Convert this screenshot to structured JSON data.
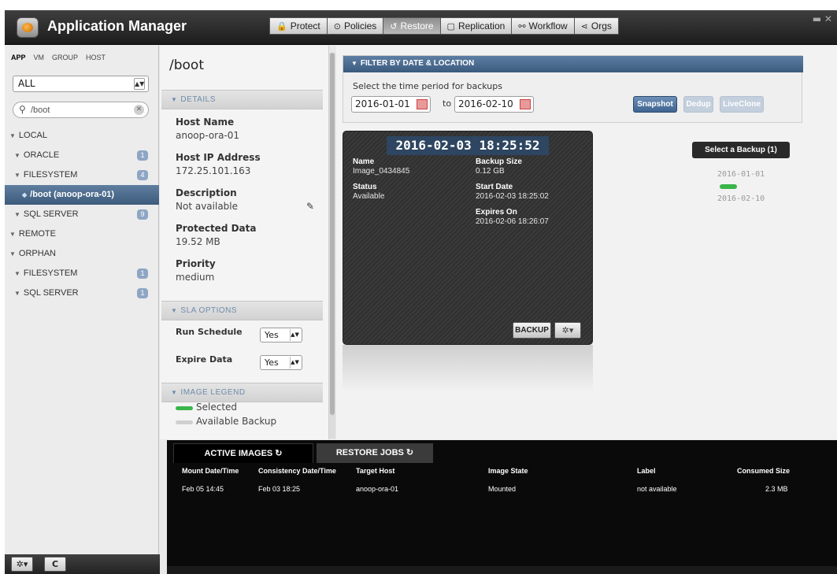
{
  "app": {
    "title": "Application Manager",
    "nav": [
      {
        "label": "Protect",
        "icon": "lock-icon",
        "glyph": "🔒"
      },
      {
        "label": "Policies",
        "icon": "policies-icon",
        "glyph": "⊙"
      },
      {
        "label": "Restore",
        "icon": "restore-icon",
        "glyph": "↺"
      },
      {
        "label": "Replication",
        "icon": "replication-icon",
        "glyph": "▢"
      },
      {
        "label": "Workflow",
        "icon": "workflow-icon",
        "glyph": "⚯"
      },
      {
        "label": "Orgs",
        "icon": "orgs-icon",
        "glyph": "⋖"
      }
    ],
    "active_tab": "Restore",
    "window_controls": "▬ ✕"
  },
  "sidebar": {
    "tabs": [
      "APP",
      "VM",
      "GROUP",
      "HOST"
    ],
    "filter_value": "ALL",
    "search_value": "/boot",
    "tree": [
      {
        "label": "LOCAL",
        "level": 0,
        "badge": ""
      },
      {
        "label": "ORACLE",
        "level": 1,
        "badge": "1"
      },
      {
        "label": "FILESYSTEM",
        "level": 1,
        "badge": "4"
      },
      {
        "label": "/boot (anoop-ora-01)",
        "level": 2,
        "badge": ""
      },
      {
        "label": "SQL SERVER",
        "level": 1,
        "badge": "9"
      },
      {
        "label": "REMOTE",
        "level": 0,
        "badge": ""
      },
      {
        "label": "ORPHAN",
        "level": 0,
        "badge": ""
      },
      {
        "label": "FILESYSTEM",
        "level": 1,
        "badge": "1"
      },
      {
        "label": "SQL SERVER",
        "level": 1,
        "badge": "1"
      }
    ],
    "bottom_buttons": {
      "settings": "✲▾",
      "refresh": "C"
    }
  },
  "details": {
    "title": "/boot",
    "section_details": "DETAILS",
    "host_name_label": "Host Name",
    "host_name_value": "anoop-ora-01",
    "host_ip_label": "Host IP Address",
    "host_ip_value": "172.25.101.163",
    "description_label": "Description",
    "description_value": "Not available",
    "protected_label": "Protected Data",
    "protected_value": "19.52 MB",
    "priority_label": "Priority",
    "priority_value": "medium",
    "section_sla": "SLA OPTIONS",
    "run_schedule_label": "Run Schedule",
    "run_schedule_value": "Yes",
    "expire_data_label": "Expire Data",
    "expire_data_value": "Yes",
    "section_legend": "IMAGE LEGEND",
    "legend_selected": "Selected",
    "legend_available": "Available Backup",
    "legend_colors": {
      "selected": "#39b54a",
      "available": "#cfcfcf"
    }
  },
  "filter": {
    "header": "FILTER BY DATE & LOCATION",
    "note": "Select the time period for backups",
    "from_date": "2016-01-01",
    "to_label": "to",
    "to_date": "2016-02-10",
    "buttons": {
      "snapshot": "Snapshot",
      "dedup": "Dedup",
      "liveclone": "LiveClone"
    }
  },
  "backup": {
    "timestamp": "2016-02-03 18:25:52",
    "name_label": "Name",
    "name_value": "Image_0434845",
    "status_label": "Status",
    "status_value": "Available",
    "size_label": "Backup Size",
    "size_value": "0.12 GB",
    "start_label": "Start Date",
    "start_value": "2016-02-03 18:25:02",
    "expires_label": "Expires On",
    "expires_value": "2016-02-06 18:26:07",
    "backup_button": "BACKUP",
    "gear_button": "✲▾"
  },
  "timeline": {
    "select_label": "Select a Backup (1)",
    "start": "2016-01-01",
    "end": "2016-02-10"
  },
  "bottom": {
    "tabs": [
      "ACTIVE IMAGES ↻",
      "RESTORE JOBS ↻"
    ],
    "columns": [
      "Mount Date/Time",
      "Consistency Date/Time",
      "Target Host",
      "Image State",
      "Label",
      "Consumed Size"
    ],
    "rows": [
      [
        "Feb 05 14:45",
        "Feb 03 18:25",
        "anoop-ora-01",
        "Mounted",
        "not available",
        "2.3 MB"
      ]
    ]
  }
}
